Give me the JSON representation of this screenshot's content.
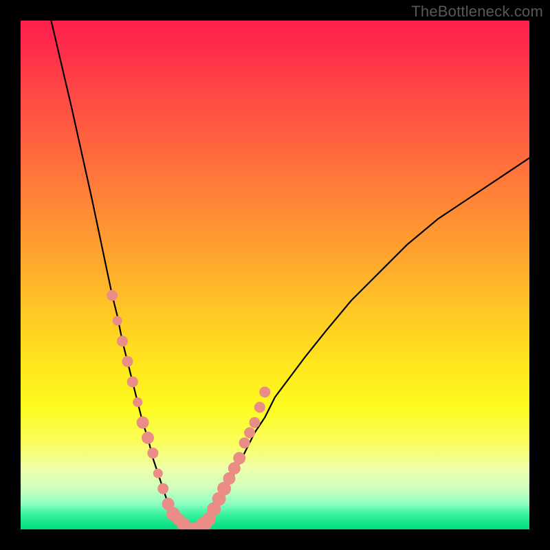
{
  "watermark": "TheBottleneck.com",
  "colors": {
    "background": "#000000",
    "curve": "#000000",
    "dot_fill": "#ea8d87",
    "watermark": "#585858"
  },
  "chart_data": {
    "type": "line",
    "title": "",
    "xlabel": "",
    "ylabel": "",
    "xlim": [
      0,
      100
    ],
    "ylim": [
      0,
      100
    ],
    "grid": false,
    "legend": false,
    "series": [
      {
        "name": "bottleneck-curve",
        "x": [
          6,
          10,
          14,
          18,
          19,
          20,
          21,
          22,
          23,
          24,
          25,
          26,
          27,
          28,
          29,
          30,
          31,
          32,
          33,
          34,
          35,
          36,
          37,
          38,
          39,
          40,
          41,
          42,
          44,
          46,
          48,
          50,
          53,
          56,
          60,
          65,
          70,
          76,
          82,
          88,
          94,
          100
        ],
        "values": [
          100,
          83,
          65,
          46,
          42,
          37,
          33,
          29,
          25,
          21,
          18,
          14,
          11,
          8,
          5,
          3,
          2,
          1,
          0,
          0,
          0,
          1,
          2,
          3,
          5,
          7,
          9,
          11,
          15,
          19,
          22,
          26,
          30,
          34,
          39,
          45,
          50,
          56,
          61,
          65,
          69,
          73
        ]
      }
    ],
    "dots": {
      "name": "marker-dots",
      "x": [
        18,
        19,
        20,
        21,
        22,
        23,
        24,
        25,
        26,
        27,
        28,
        29,
        30,
        31,
        32,
        33,
        34,
        35,
        36,
        37,
        38,
        39,
        40,
        41,
        42,
        43,
        44,
        45,
        46,
        47,
        48
      ],
      "values": [
        46,
        41,
        37,
        33,
        29,
        25,
        21,
        18,
        15,
        11,
        8,
        5,
        3,
        2,
        1,
        0,
        0,
        0,
        1,
        2,
        4,
        6,
        8,
        10,
        12,
        14,
        17,
        19,
        21,
        24,
        27
      ],
      "radius": [
        8,
        7,
        8,
        8,
        8,
        7,
        9,
        9,
        8,
        7,
        8,
        9,
        10,
        9,
        10,
        10,
        10,
        11,
        11,
        10,
        10,
        10,
        10,
        9,
        9,
        9,
        8,
        8,
        8,
        8,
        8
      ]
    }
  }
}
